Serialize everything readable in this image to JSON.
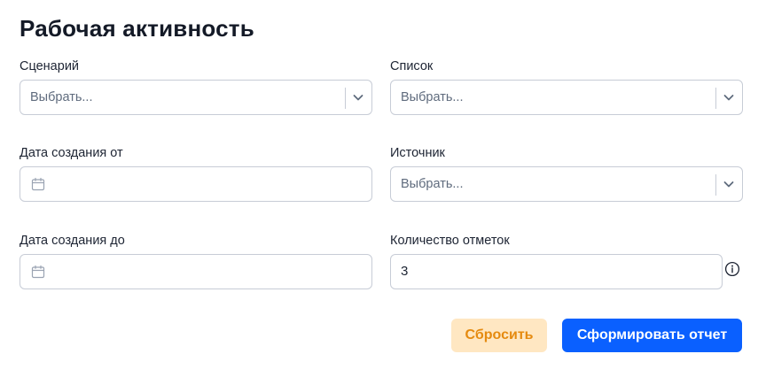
{
  "page": {
    "title": "Рабочая активность"
  },
  "form": {
    "scenario": {
      "label": "Сценарий",
      "placeholder": "Выбрать..."
    },
    "list": {
      "label": "Список",
      "placeholder": "Выбрать..."
    },
    "created_from": {
      "label": "Дата создания от",
      "value": ""
    },
    "source": {
      "label": "Источник",
      "placeholder": "Выбрать..."
    },
    "created_to": {
      "label": "Дата создания до",
      "value": ""
    },
    "marks_count": {
      "label": "Количество отметок",
      "value": "3"
    }
  },
  "actions": {
    "reset_label": "Сбросить",
    "submit_label": "Сформировать отчет"
  },
  "colors": {
    "primary": "#0a60ff",
    "reset_background": "#ffe7c2",
    "reset_text": "#e58a0f",
    "border": "#c7ccd6",
    "placeholder": "#5f6b7d"
  },
  "icons": {
    "select_arrow": "chevron-down-icon",
    "date": "calendar-icon",
    "info": "info-icon"
  }
}
